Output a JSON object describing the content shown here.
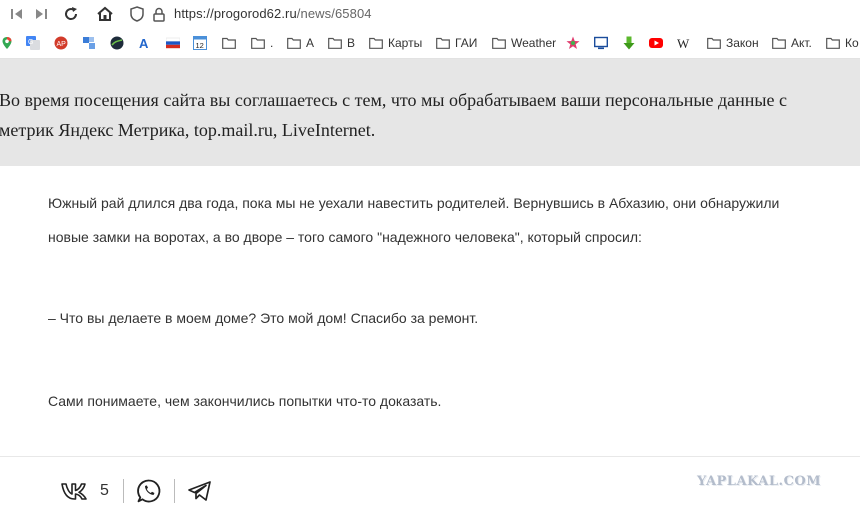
{
  "browser": {
    "url_host": "https://progorod62.ru",
    "url_path": "/news/65804",
    "nav": [
      "back-icon",
      "forward-icon",
      "reload-icon",
      "home-icon",
      "shield-icon",
      "lock-icon"
    ]
  },
  "bookmarks": [
    {
      "icon": "google-maps-icon",
      "label": ""
    },
    {
      "icon": "google-translate-icon",
      "label": ""
    },
    {
      "icon": "red-circle-icon",
      "label": ""
    },
    {
      "icon": "blue-tiles-icon",
      "label": ""
    },
    {
      "icon": "sphere-icon",
      "label": ""
    },
    {
      "icon": "letter-a-icon",
      "label": ""
    },
    {
      "icon": "russia-flag-icon",
      "label": ""
    },
    {
      "icon": "calendar-12-icon",
      "label": ""
    },
    {
      "icon": "folder-icon",
      "label": ""
    },
    {
      "icon": "folder-icon",
      "label": "."
    },
    {
      "icon": "folder-icon",
      "label": "А"
    },
    {
      "icon": "folder-icon",
      "label": "В"
    },
    {
      "icon": "folder-icon",
      "label": "Карты"
    },
    {
      "icon": "folder-icon",
      "label": "ГАИ"
    },
    {
      "icon": "folder-icon",
      "label": "Weather"
    },
    {
      "icon": "star-color-icon",
      "label": ""
    },
    {
      "icon": "monitor-icon",
      "label": ""
    },
    {
      "icon": "download-arrow-icon",
      "label": ""
    },
    {
      "icon": "youtube-icon",
      "label": ""
    },
    {
      "icon": "wikipedia-icon",
      "label": ""
    },
    {
      "icon": "folder-icon",
      "label": "Закон"
    },
    {
      "icon": "folder-icon",
      "label": "Акт."
    },
    {
      "icon": "folder-icon",
      "label": "Ко"
    }
  ],
  "cookie_banner": {
    "line1": "Во время посещения сайта вы соглашаетесь с тем, что мы обрабатываем ваши персональные данные с",
    "line2": "метрик Яндекс Метрика, top.mail.ru, LiveInternet."
  },
  "article": {
    "p1_line1": "Южный рай длился два года, пока мы не уехали навестить родителей. Вернувшись в Абхазию, они обнаружили",
    "p1_line2": "новые замки на воротах, а во дворе – того самого \"надежного человека\", который спросил:",
    "p2": "– Что вы делаете в моем доме? Это мой дом! Спасибо за ремонт.",
    "p3": "Сами понимаете, чем закончились попытки что-то доказать."
  },
  "share": {
    "vk_count": "5",
    "icons": [
      "vk-icon",
      "whatsapp-icon",
      "telegram-icon"
    ]
  },
  "watermark": "YAPLAKAL.COM"
}
